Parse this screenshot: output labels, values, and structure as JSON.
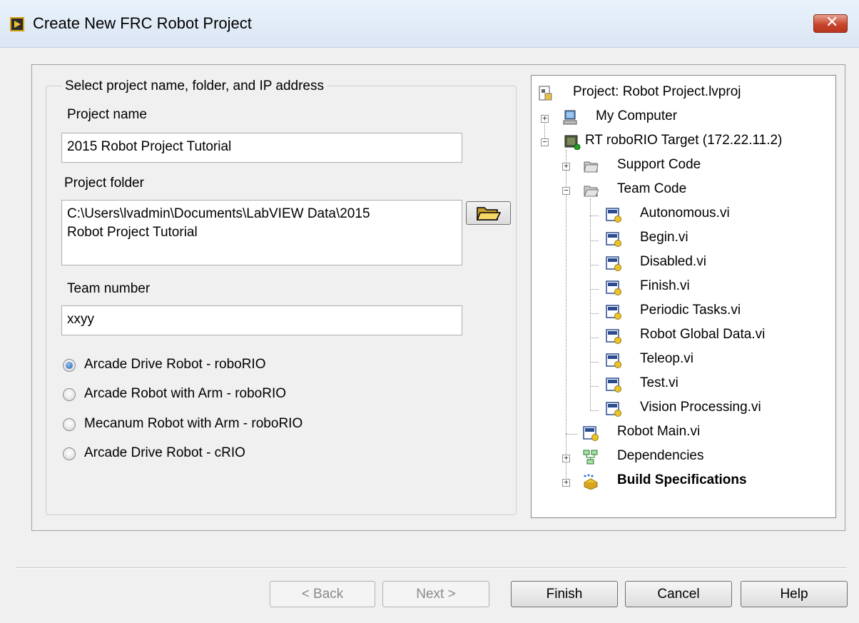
{
  "window": {
    "title": "Create New FRC Robot Project",
    "close_glyph": "✕"
  },
  "form": {
    "group_title": "Select project name, folder, and IP address",
    "project_name": {
      "label": "Project name",
      "value": "2015 Robot Project Tutorial"
    },
    "project_folder": {
      "label": "Project folder",
      "value_line1": "C:\\Users\\lvadmin\\Documents\\LabVIEW Data\\2015",
      "value_line2": "Robot Project Tutorial"
    },
    "team_number": {
      "label": "Team number",
      "value": "xxyy"
    },
    "templates": [
      {
        "label": "Arcade Drive Robot - roboRIO",
        "selected": true
      },
      {
        "label": "Arcade Robot with Arm - roboRIO",
        "selected": false
      },
      {
        "label": "Mecanum Robot with Arm - roboRIO",
        "selected": false
      },
      {
        "label": "Arcade Drive Robot - cRIO",
        "selected": false
      }
    ]
  },
  "tree": {
    "project": "Project: Robot Project.lvproj",
    "my_computer": "My Computer",
    "target": "RT roboRIO Target (172.22.11.2)",
    "support_code": "Support Code",
    "team_code": "Team Code",
    "team_code_items": [
      "Autonomous.vi",
      "Begin.vi",
      "Disabled.vi",
      "Finish.vi",
      "Periodic Tasks.vi",
      "Robot Global Data.vi",
      "Teleop.vi",
      "Test.vi",
      "Vision Processing.vi"
    ],
    "robot_main": "Robot Main.vi",
    "dependencies": "Dependencies",
    "build_specs": "Build Specifications"
  },
  "buttons": {
    "back": "< Back",
    "next": "Next >",
    "finish": "Finish",
    "cancel": "Cancel",
    "help": "Help"
  },
  "colors": {
    "title_bar": "#dde8f5",
    "close_button": "#c7452c",
    "radio_selected": "#1f5fae"
  }
}
